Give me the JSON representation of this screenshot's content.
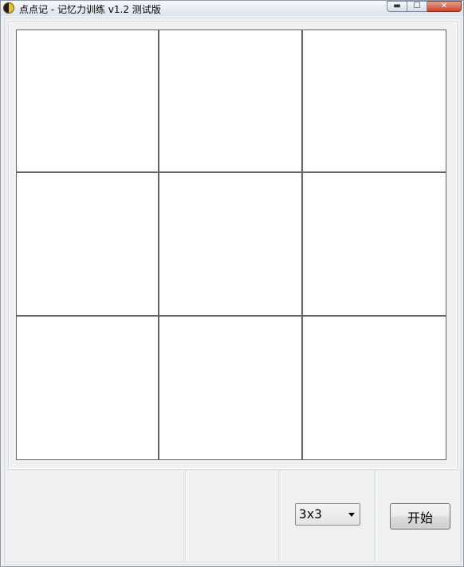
{
  "window": {
    "title": "点点记 - 记忆力训练 v1.2 测试版",
    "min_glyph": "▬",
    "max_glyph": "☐",
    "close_glyph": "✕"
  },
  "board": {
    "rows": 3,
    "cols": 3
  },
  "controls": {
    "size_select_value": "3x3",
    "start_label": "开始"
  },
  "icons": {
    "app": "app-icon",
    "dropdown": "chevron-down-icon"
  },
  "colors": {
    "grid_line": "#646464",
    "cell_bg": "#ffffff",
    "window_bg": "#f0f0f0",
    "close_button": "#c9442a"
  }
}
